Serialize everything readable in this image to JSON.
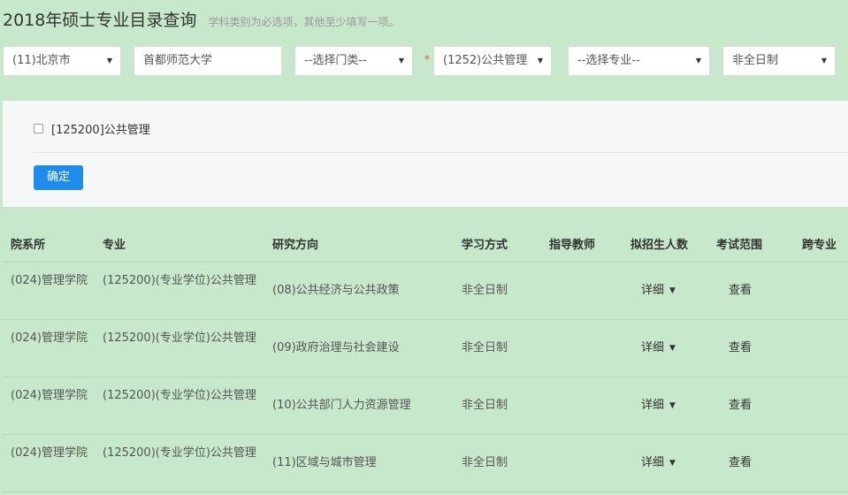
{
  "header": {
    "title": "2018年硕士专业目录查询",
    "hint": "学科类别为必选项，其他至少填写一项。"
  },
  "filters": {
    "province": "(11)北京市",
    "school": "首都师范大学",
    "category": "--选择门类--",
    "required_mark": "*",
    "discipline": "(1252)公共管理",
    "major": "--选择专业--",
    "study_mode": "非全日制"
  },
  "panel": {
    "checkbox_label": "[125200]公共管理",
    "confirm_label": "确定"
  },
  "table": {
    "headers": [
      "院系所",
      "专业",
      "研究方向",
      "学习方式",
      "指导教师",
      "拟招生人数",
      "考试范围",
      "跨专业"
    ],
    "rows": [
      {
        "dept": "(024)管理学院",
        "major": "(125200)(专业学位)公共管理",
        "direction": "(08)公共经济与公共政策",
        "mode": "非全日制",
        "advisor": "",
        "quota": "详细",
        "scope": "查看"
      },
      {
        "dept": "(024)管理学院",
        "major": "(125200)(专业学位)公共管理",
        "direction": "(09)政府治理与社会建设",
        "mode": "非全日制",
        "advisor": "",
        "quota": "详细",
        "scope": "查看"
      },
      {
        "dept": "(024)管理学院",
        "major": "(125200)(专业学位)公共管理",
        "direction": "(10)公共部门人力资源管理",
        "mode": "非全日制",
        "advisor": "",
        "quota": "详细",
        "scope": "查看"
      },
      {
        "dept": "(024)管理学院",
        "major": "(125200)(专业学位)公共管理",
        "direction": "(11)区域与城市管理",
        "mode": "非全日制",
        "advisor": "",
        "quota": "详细",
        "scope": "查看"
      }
    ]
  },
  "colors": {
    "page_background": "#c7e8cb",
    "primary_button": "#1f8ceb",
    "required_mark": "#e55555"
  }
}
